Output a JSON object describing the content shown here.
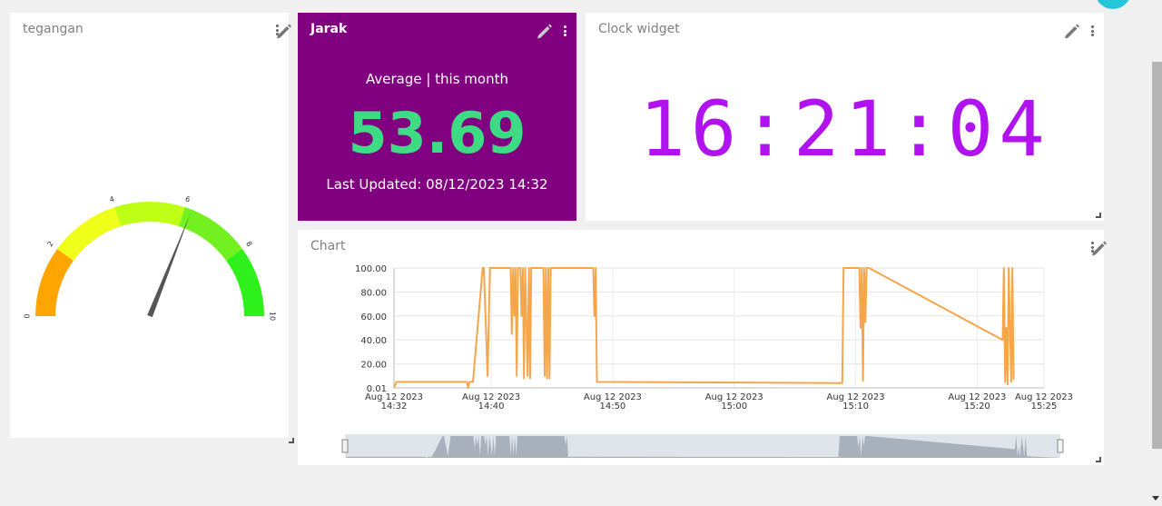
{
  "widgets": {
    "gauge": {
      "title": "tegangan",
      "value": 6.2,
      "min": 0,
      "max": 10,
      "ticks": [
        "0",
        "2",
        "4",
        "6",
        "8",
        "10"
      ],
      "bands": [
        {
          "from": 0,
          "to": 2,
          "color": "#ffa500"
        },
        {
          "from": 2,
          "to": 4,
          "color": "#f0ff1a"
        },
        {
          "from": 4,
          "to": 6,
          "color": "#bfff15"
        },
        {
          "from": 6,
          "to": 8,
          "color": "#73f01f"
        },
        {
          "from": 8,
          "to": 10,
          "color": "#2ef01a"
        }
      ]
    },
    "jarak": {
      "title": "Jarak",
      "subtitle": "Average | this month",
      "value": "53.69",
      "last_updated": "Last Updated: 08/12/2023 14:32",
      "bg_color": "#800080",
      "value_color": "#3ddc84"
    },
    "clock": {
      "title": "Clock widget",
      "time": "16:21:04",
      "color": "#b012f0"
    },
    "chart": {
      "title": "Chart"
    }
  },
  "chart_data": {
    "type": "line",
    "color": "#f5a54a",
    "y_tick_labels": [
      "100.00",
      "80.00",
      "60.00",
      "40.00",
      "20.00",
      "0.01"
    ],
    "ylim": [
      0.01,
      100
    ],
    "x_tick_labels": [
      {
        "date": "Aug 12 2023",
        "time": "14:32",
        "minutes": 0
      },
      {
        "date": "Aug 12 2023",
        "time": "14:40",
        "minutes": 8
      },
      {
        "date": "Aug 12 2023",
        "time": "14:50",
        "minutes": 18
      },
      {
        "date": "Aug 12 2023",
        "time": "15:00",
        "minutes": 28
      },
      {
        "date": "Aug 12 2023",
        "time": "15:10",
        "minutes": 38
      },
      {
        "date": "Aug 12 2023",
        "time": "15:20",
        "minutes": 48
      },
      {
        "date": "Aug 12 2023",
        "time": "15:25",
        "minutes": 53.5
      }
    ],
    "xlim_minutes": [
      0,
      53.5
    ],
    "points": [
      [
        0.0,
        0.01
      ],
      [
        0.2,
        5
      ],
      [
        6.0,
        5
      ],
      [
        6.1,
        0.01
      ],
      [
        6.2,
        5
      ],
      [
        6.5,
        5
      ],
      [
        7.3,
        100
      ],
      [
        7.4,
        100
      ],
      [
        7.7,
        10
      ],
      [
        7.9,
        100
      ],
      [
        8.3,
        100
      ],
      [
        8.5,
        100
      ],
      [
        9.6,
        100
      ],
      [
        9.7,
        45
      ],
      [
        9.8,
        100
      ],
      [
        9.9,
        60
      ],
      [
        10.0,
        100
      ],
      [
        10.1,
        10
      ],
      [
        10.2,
        100
      ],
      [
        10.4,
        100
      ],
      [
        10.5,
        60
      ],
      [
        10.6,
        100
      ],
      [
        10.7,
        8
      ],
      [
        10.8,
        100
      ],
      [
        11.0,
        10
      ],
      [
        11.1,
        100
      ],
      [
        11.2,
        8
      ],
      [
        11.3,
        100
      ],
      [
        12.3,
        100
      ],
      [
        12.4,
        10
      ],
      [
        12.5,
        100
      ],
      [
        12.6,
        8
      ],
      [
        12.7,
        100
      ],
      [
        12.8,
        8
      ],
      [
        12.9,
        100
      ],
      [
        16.4,
        100
      ],
      [
        16.5,
        60
      ],
      [
        16.6,
        100
      ],
      [
        16.7,
        5
      ],
      [
        36.9,
        4
      ],
      [
        37.0,
        100
      ],
      [
        38.3,
        100
      ],
      [
        38.4,
        50
      ],
      [
        38.5,
        100
      ],
      [
        38.6,
        6
      ],
      [
        38.7,
        100
      ],
      [
        38.8,
        55
      ],
      [
        38.9,
        100
      ],
      [
        39.1,
        100
      ],
      [
        50.1,
        40
      ],
      [
        50.2,
        100
      ],
      [
        50.3,
        5
      ],
      [
        50.4,
        50
      ],
      [
        50.5,
        3
      ],
      [
        50.6,
        100
      ],
      [
        50.8,
        5
      ],
      [
        50.9,
        100
      ],
      [
        51.0,
        7
      ]
    ]
  }
}
